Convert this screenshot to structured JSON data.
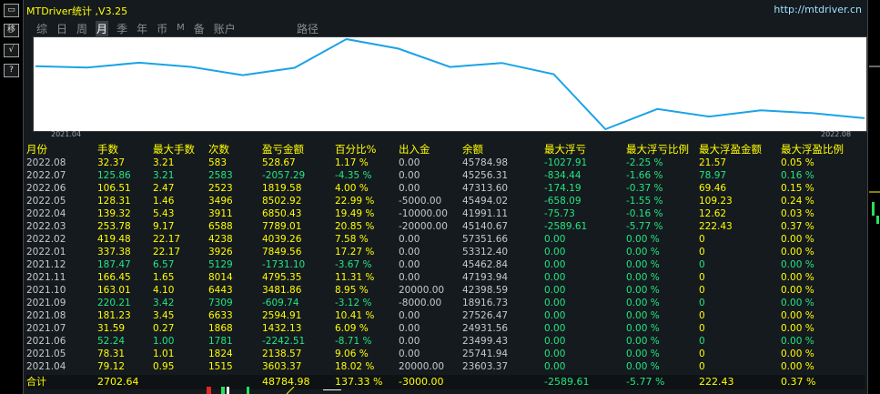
{
  "app": {
    "title": "MTDriver统计 ,V3.25",
    "url": "http://mtdriver.cn"
  },
  "toolbar": [
    "▭",
    "移",
    "√",
    "?"
  ],
  "tabs": [
    {
      "label": "综",
      "active": false
    },
    {
      "label": "日",
      "active": false
    },
    {
      "label": "周",
      "active": false
    },
    {
      "label": "月",
      "active": true
    },
    {
      "label": "季",
      "active": false
    },
    {
      "label": "年",
      "active": false
    },
    {
      "label": "币",
      "active": false
    },
    {
      "label": "M",
      "active": false
    },
    {
      "label": "备",
      "active": false
    },
    {
      "label": "账户",
      "active": false
    }
  ],
  "path_label": "路径",
  "chart_data": {
    "type": "line",
    "x_labels": [
      "2021.04",
      "2022.08"
    ],
    "line_color": "#1aa3e6",
    "values": [
      23603.37,
      25741.94,
      26961.31,
      24313.59,
      27526.47,
      18916.73,
      42398.59,
      47193.94,
      45462.84,
      53312.4,
      57351.66,
      45140.67,
      41991.11,
      45494.02,
      47313.6,
      45256.31,
      45784.98
    ]
  },
  "table": {
    "headers": [
      "月份",
      "手数",
      "最大手数",
      "次数",
      "盈亏金额",
      "百分比%",
      "出入金",
      "余额",
      "最大浮亏",
      "最大浮亏比例",
      "最大浮盈金额",
      "最大浮盈比例"
    ],
    "rows": [
      {
        "c": "yel",
        "v": [
          "2022.08",
          "32.37",
          "3.21",
          "583",
          "528.67",
          "1.17 %",
          "0.00",
          "45784.98",
          "-1027.91",
          "-2.25 %",
          "21.57",
          "0.05 %"
        ]
      },
      {
        "c": "grn",
        "v": [
          "2022.07",
          "125.86",
          "3.21",
          "2583",
          "-2057.29",
          "-4.35 %",
          "0.00",
          "45256.31",
          "-834.44",
          "-1.66 %",
          "78.97",
          "0.16 %"
        ]
      },
      {
        "c": "yel",
        "v": [
          "2022.06",
          "106.51",
          "2.47",
          "2523",
          "1819.58",
          "4.00 %",
          "0.00",
          "47313.60",
          "-174.19",
          "-0.37 %",
          "69.46",
          "0.15 %"
        ]
      },
      {
        "c": "yel",
        "v": [
          "2022.05",
          "128.31",
          "1.46",
          "3496",
          "8502.92",
          "22.99 %",
          "-5000.00",
          "45494.02",
          "-658.09",
          "-1.55 %",
          "109.23",
          "0.24 %"
        ]
      },
      {
        "c": "yel",
        "v": [
          "2022.04",
          "139.32",
          "5.43",
          "3911",
          "6850.43",
          "19.49 %",
          "-10000.00",
          "41991.11",
          "-75.73",
          "-0.16 %",
          "12.62",
          "0.03 %"
        ]
      },
      {
        "c": "yel",
        "v": [
          "2022.03",
          "253.78",
          "9.17",
          "6588",
          "7789.01",
          "20.85 %",
          "-20000.00",
          "45140.67",
          "-2589.61",
          "-5.77 %",
          "222.43",
          "0.37 %"
        ]
      },
      {
        "c": "yel",
        "v": [
          "2022.02",
          "419.48",
          "22.17",
          "4238",
          "4039.26",
          "7.58 %",
          "0.00",
          "57351.66",
          "0.00",
          "0.00 %",
          "0",
          "0.00 %"
        ]
      },
      {
        "c": "yel",
        "v": [
          "2022.01",
          "337.38",
          "22.17",
          "3926",
          "7849.56",
          "17.27 %",
          "0.00",
          "53312.40",
          "0.00",
          "0.00 %",
          "0",
          "0.00 %"
        ]
      },
      {
        "c": "grn",
        "v": [
          "2021.12",
          "187.47",
          "6.57",
          "5129",
          "-1731.10",
          "-3.67 %",
          "0.00",
          "45462.84",
          "0.00",
          "0.00 %",
          "0",
          "0.00 %"
        ]
      },
      {
        "c": "yel",
        "v": [
          "2021.11",
          "166.45",
          "1.65",
          "8014",
          "4795.35",
          "11.31 %",
          "0.00",
          "47193.94",
          "0.00",
          "0.00 %",
          "0",
          "0.00 %"
        ]
      },
      {
        "c": "yel",
        "v": [
          "2021.10",
          "163.01",
          "4.10",
          "6443",
          "3481.86",
          "8.95 %",
          "20000.00",
          "42398.59",
          "0.00",
          "0.00 %",
          "0",
          "0.00 %"
        ]
      },
      {
        "c": "grn",
        "v": [
          "2021.09",
          "220.21",
          "3.42",
          "7309",
          "-609.74",
          "-3.12 %",
          "-8000.00",
          "18916.73",
          "0.00",
          "0.00 %",
          "0",
          "0.00 %"
        ]
      },
      {
        "c": "yel",
        "v": [
          "2021.08",
          "181.23",
          "3.45",
          "6633",
          "2594.91",
          "10.41 %",
          "0.00",
          "27526.47",
          "0.00",
          "0.00 %",
          "0",
          "0.00 %"
        ]
      },
      {
        "c": "yel",
        "v": [
          "2021.07",
          "31.59",
          "0.27",
          "1868",
          "1432.13",
          "6.09 %",
          "0.00",
          "24931.56",
          "0.00",
          "0.00 %",
          "0",
          "0.00 %"
        ]
      },
      {
        "c": "grn",
        "v": [
          "2021.06",
          "52.24",
          "1.00",
          "1781",
          "-2242.51",
          "-8.71 %",
          "0.00",
          "23499.43",
          "0.00",
          "0.00 %",
          "0",
          "0.00 %"
        ]
      },
      {
        "c": "yel",
        "v": [
          "2021.05",
          "78.31",
          "1.01",
          "1824",
          "2138.57",
          "9.06 %",
          "0.00",
          "25741.94",
          "0.00",
          "0.00 %",
          "0",
          "0.00 %"
        ]
      },
      {
        "c": "yel",
        "v": [
          "2021.04",
          "79.12",
          "0.95",
          "1515",
          "3603.37",
          "18.02 %",
          "20000.00",
          "23603.37",
          "0.00",
          "0.00 %",
          "0",
          "0.00 %"
        ]
      }
    ],
    "footer": {
      "label": "合计",
      "lots": "2702.64",
      "pnl": "48784.98",
      "pct": "137.33 %",
      "flow": "-3000.00",
      "max_float_loss": "-2589.61",
      "max_float_loss_pct": "-5.77 %",
      "max_float_profit": "222.43",
      "max_float_profit_pct": "0.37 %"
    }
  }
}
